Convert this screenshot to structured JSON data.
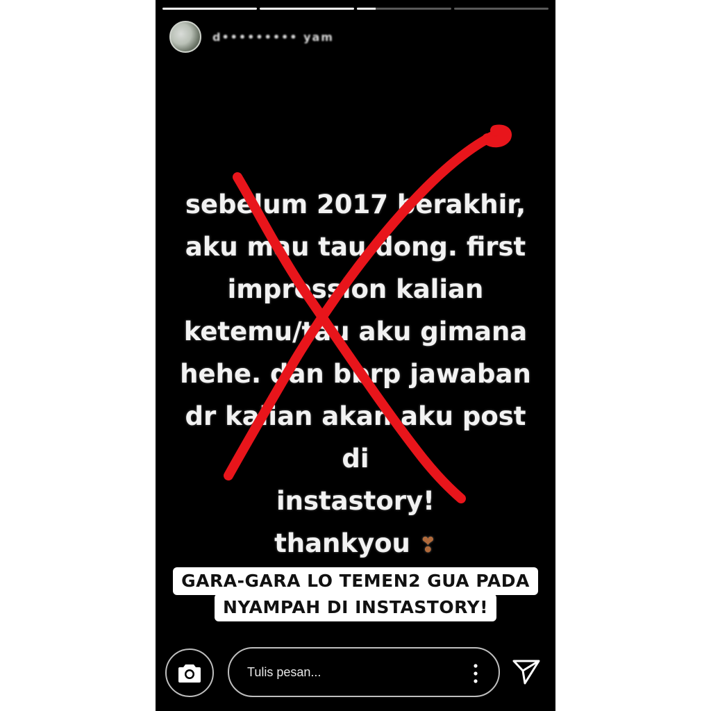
{
  "progress": {
    "segments": [
      1.0,
      1.0,
      0.2,
      0.0
    ]
  },
  "header": {
    "username": "d••••••••• yam"
  },
  "story": {
    "text": "sebelum 2017 berakhir,\naku mau tau dong. first\nimpression kalian\nketemu/tau aku gimana\nhehe. dan bbrp jawaban\ndr kalian akan aku post di\ninstastory!\nthankyou",
    "heart": "❣",
    "cross_color": "#e8151b"
  },
  "caption": {
    "line1": "GARA-GARA LO TEMEN2 GUA PADA",
    "line2": "NYAMPAH DI INSTASTORY!"
  },
  "footer": {
    "message_placeholder": "Tulis pesan...",
    "camera_icon": "camera-icon",
    "more_icon": "more-vertical-icon",
    "send_icon": "send-icon"
  }
}
